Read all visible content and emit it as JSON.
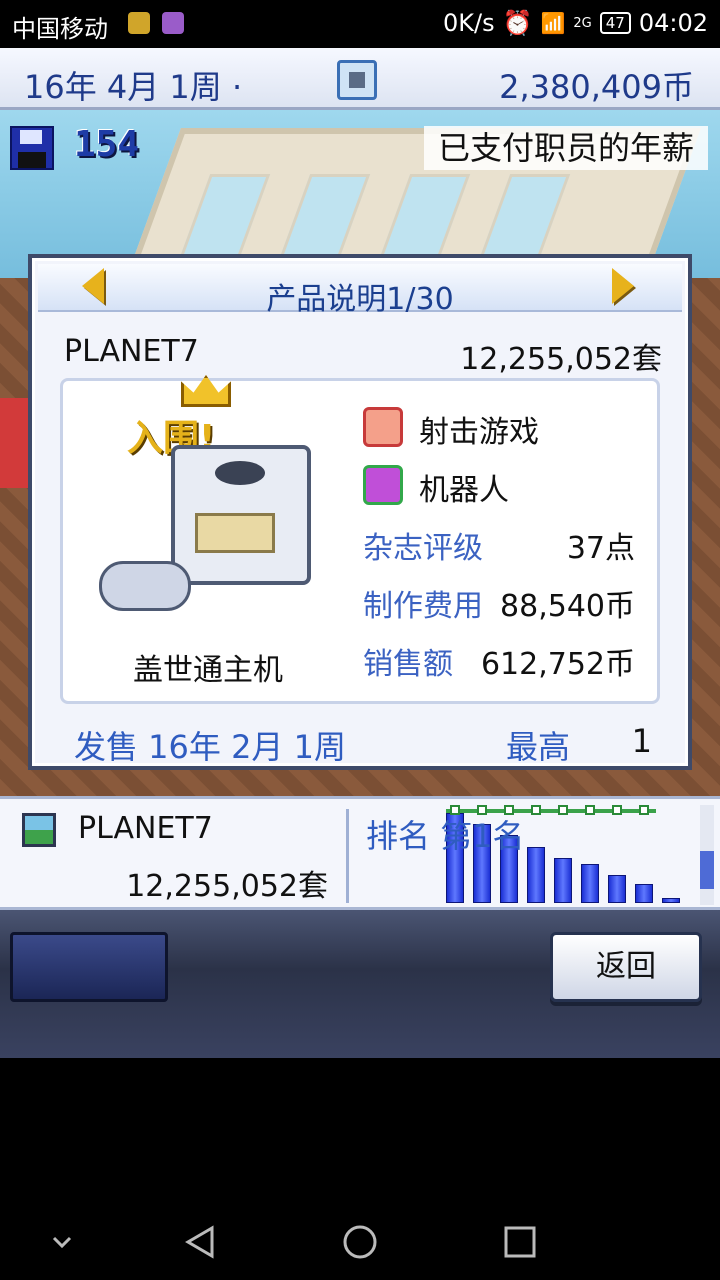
{
  "status_bar": {
    "carrier": "中国移动",
    "net_speed": "0K/s",
    "network_type": "2G",
    "battery": "47",
    "time": "04:02"
  },
  "topbar": {
    "date": "16年 4月 1周 ·",
    "money": "2,380,409币"
  },
  "save": {
    "count": "154"
  },
  "notice": "已支付职员的年薪",
  "dialog": {
    "title": "产品说明1/30",
    "product_name": "PLANET7",
    "units_sold": "12,255,052套",
    "award": "入围!",
    "platform": "盖世通主机",
    "genre": "射击游戏",
    "type": "机器人",
    "stats": [
      {
        "label": "杂志评级",
        "value": "37点"
      },
      {
        "label": "制作费用",
        "value": "88,540币"
      },
      {
        "label": "销售额",
        "value": "612,752币"
      }
    ],
    "release_label": "发售 16年 2月 1周",
    "best_label": "最高",
    "best_value": "1"
  },
  "ranking": {
    "name": "PLANET7",
    "units": "12,255,052套",
    "rank_label": "排名 第1名",
    "bar_values": [
      8,
      7,
      6,
      5,
      4,
      3.5,
      2.5,
      1.7,
      0.4
    ]
  },
  "controls": {
    "back_label": "返回"
  },
  "colors": {
    "accent_blue": "#2f5cc0",
    "title_blue": "#1b3f8f",
    "gold": "#e7b21c",
    "bar_blue": "#1b2fd4",
    "grid_green": "#3aa24a"
  },
  "icons": [
    "floppy-disk-icon",
    "prev-arrow-icon",
    "next-arrow-icon",
    "crown-icon",
    "console-icon",
    "gamepad-icon",
    "genre-face-icon",
    "type-gem-icon",
    "product-thumbnail-icon",
    "back-nav-icon",
    "home-nav-icon",
    "recents-nav-icon"
  ]
}
